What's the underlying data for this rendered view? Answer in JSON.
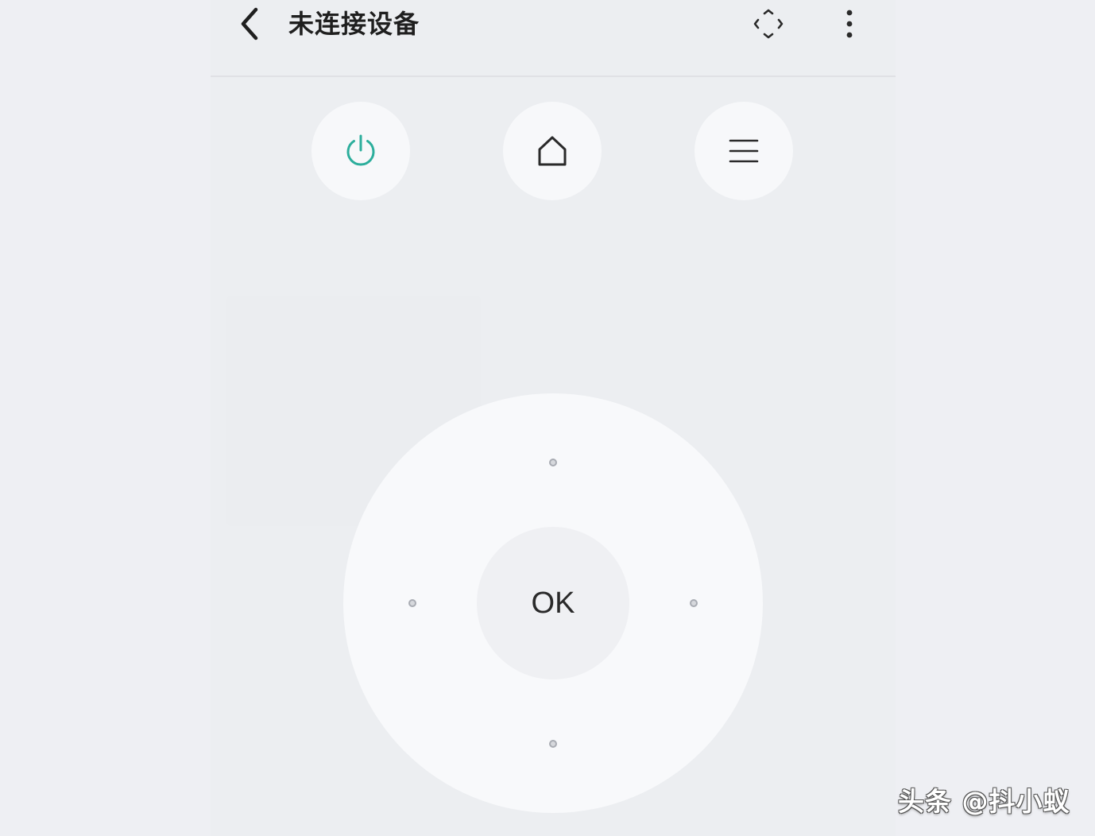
{
  "header": {
    "title": "未连接设备",
    "back_icon": "chevron-left-icon",
    "scan_icon": "focus-frame-icon",
    "more_icon": "more-vertical-icon"
  },
  "quick_actions": [
    {
      "name": "power",
      "icon": "power-icon",
      "color": "#2cae9c"
    },
    {
      "name": "home",
      "icon": "home-icon",
      "color": "#2a2a2a"
    },
    {
      "name": "menu",
      "icon": "menu-icon",
      "color": "#2a2a2a"
    }
  ],
  "dpad": {
    "ok_label": "OK"
  },
  "watermark": {
    "text": "头条 @抖小蚁"
  },
  "colors": {
    "accent": "#2cae9c",
    "background": "#eceef1",
    "button": "#f7f8fa"
  }
}
